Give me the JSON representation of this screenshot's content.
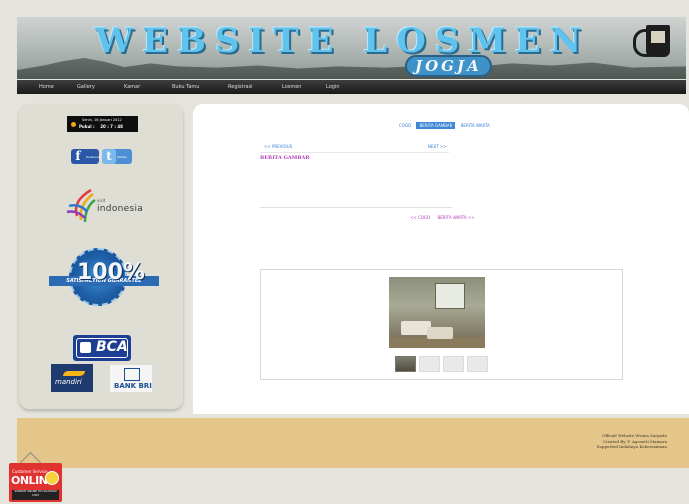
{
  "banner": {
    "title": "WEBSITE LOSMEN",
    "subtitle": "JOGJA"
  },
  "nav": {
    "items": [
      "Home",
      "Gallery",
      "Kamar",
      "Buku Tamu",
      "Registrasi",
      "Losmen",
      "Login"
    ]
  },
  "sidebar": {
    "clock": {
      "date": "Senin, 16 Januari 2012",
      "time_label": "Pukul :",
      "time": "20 : 7 : 48"
    },
    "social": {
      "facebook_label": "facebook",
      "twitter_label": "twitter"
    },
    "indonesia": {
      "small": "visit",
      "word": "indonesia"
    },
    "guarantee": {
      "pct": "100%",
      "ribbon": "SATISFACTION GUARANTEE"
    },
    "banks": {
      "bca": "BCA",
      "mandiri": "mandiri",
      "bri": "BANK BRI"
    }
  },
  "main": {
    "tabs": [
      "COGO",
      "BERITA GAMBAR",
      "BERITA WARTA"
    ],
    "active_tab_index": 1,
    "prev": "<< PREVIOUS",
    "next": "NEXT >>",
    "heading": "BERITA GAMBAR",
    "bottom_links": [
      "<< COGO",
      "BERITA WARTA >>"
    ],
    "gallery": {
      "thumb_count": 4
    }
  },
  "footer": {
    "lines": [
      "Official Website Wisma Sargede",
      "Created By © Agosetti Mamara",
      "Supported Indahnya Kebersamaan"
    ]
  },
  "online": {
    "top": "Customer Service",
    "word": "ONLINE",
    "bottom": "SUPPORT ONLINE YM! SILAHKAN CHAT"
  }
}
